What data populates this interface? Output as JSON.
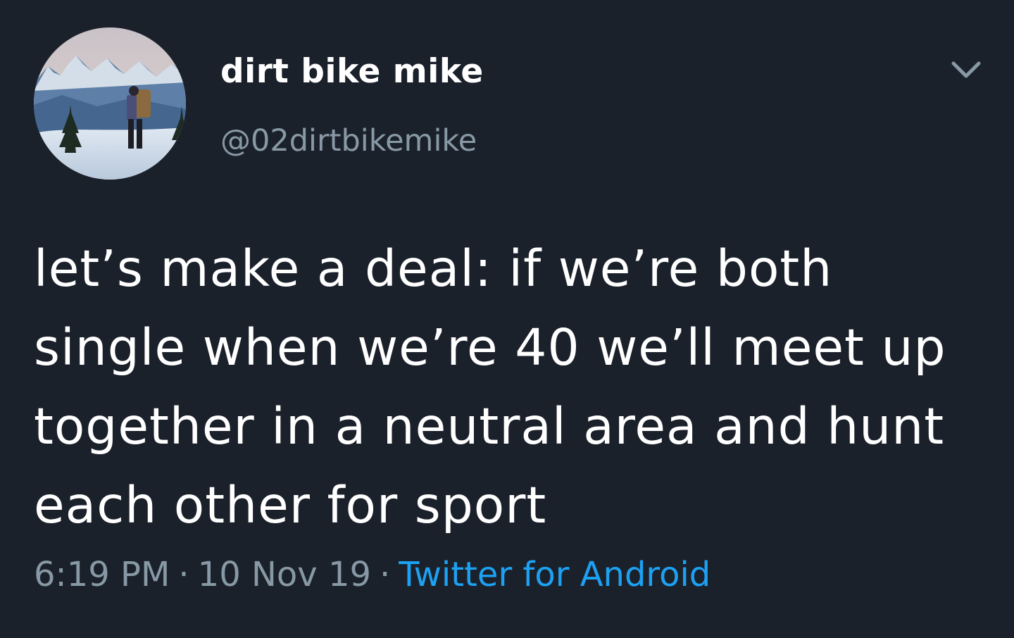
{
  "tweet": {
    "display_name": "dirt bike mike",
    "handle": "@02dirtbikemike",
    "text": "let’s make a deal: if we’re both single when we’re 40 we’ll meet up together in a neutral area and hunt each other for sport",
    "time": "6:19 PM",
    "date": "10 Nov 19",
    "source": "Twitter for Android",
    "separator": "·"
  },
  "icons": {
    "avatar": "avatar-photo-hiker-snowy-mountains",
    "menu": "chevron-down-icon"
  },
  "colors": {
    "background": "#1b212b",
    "primary_text": "#ffffff",
    "secondary_text": "#8899a6",
    "accent": "#1da1f2"
  }
}
